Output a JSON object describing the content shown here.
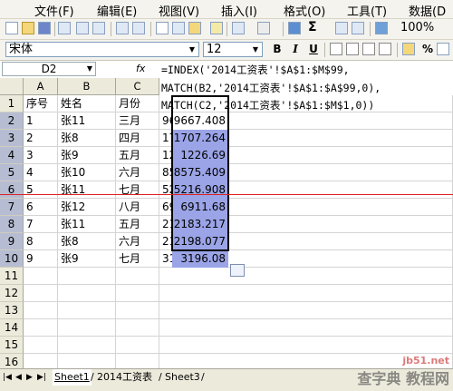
{
  "menu": [
    "文件(F)",
    "编辑(E)",
    "视图(V)",
    "插入(I)",
    "格式(O)",
    "工具(T)",
    "数据(D"
  ],
  "toolbar": {
    "zoom": "100%",
    "sigma": "Σ"
  },
  "format_bar": {
    "font_name": "宋体",
    "font_size": "12",
    "bold": "B",
    "italic": "I",
    "underline": "U",
    "percent": "%"
  },
  "formula_bar": {
    "name_box": "D2",
    "fx": "fx",
    "lines": [
      "=INDEX('2014工资表'!$A$1:$M$99,",
      "MATCH(B2,'2014工资表'!$A$1:$A$99,0),",
      "MATCH(C2,'2014工资表'!$A$1:$M$1,0))"
    ]
  },
  "grid": {
    "columns": [
      "A",
      "B",
      "C"
    ],
    "row_numbers": [
      "1",
      "2",
      "3",
      "4",
      "5",
      "6",
      "7",
      "8",
      "9",
      "10",
      "11",
      "12",
      "13",
      "14",
      "15",
      "16"
    ],
    "rows": [
      {
        "a": "序号",
        "b": "姓名",
        "c": "月份",
        "d": ""
      },
      {
        "a": "1",
        "b": "张11",
        "c": "三月",
        "d": "9667.408"
      },
      {
        "a": "2",
        "b": "张8",
        "c": "四月",
        "d": "1707.264"
      },
      {
        "a": "3",
        "b": "张9",
        "c": "五月",
        "d": "1226.69"
      },
      {
        "a": "4",
        "b": "张10",
        "c": "六月",
        "d": "8575.409"
      },
      {
        "a": "5",
        "b": "张11",
        "c": "七月",
        "d": "5216.908"
      },
      {
        "a": "6",
        "b": "张12",
        "c": "八月",
        "d": "6911.68"
      },
      {
        "a": "7",
        "b": "张11",
        "c": "五月",
        "d": "2183.217"
      },
      {
        "a": "8",
        "b": "张8",
        "c": "六月",
        "d": "2198.077"
      },
      {
        "a": "9",
        "b": "张9",
        "c": "七月",
        "d": "3196.08"
      }
    ]
  },
  "sheet_tabs": [
    "Sheet1",
    "2014工资表",
    "Sheet3"
  ],
  "watermark": {
    "line1": "jb51.net",
    "line2": "查字典 教程网"
  },
  "colors": {
    "selection": "#9aa4e6",
    "row_header_selected": "#b6bdd2",
    "red_line": "#e02020"
  }
}
